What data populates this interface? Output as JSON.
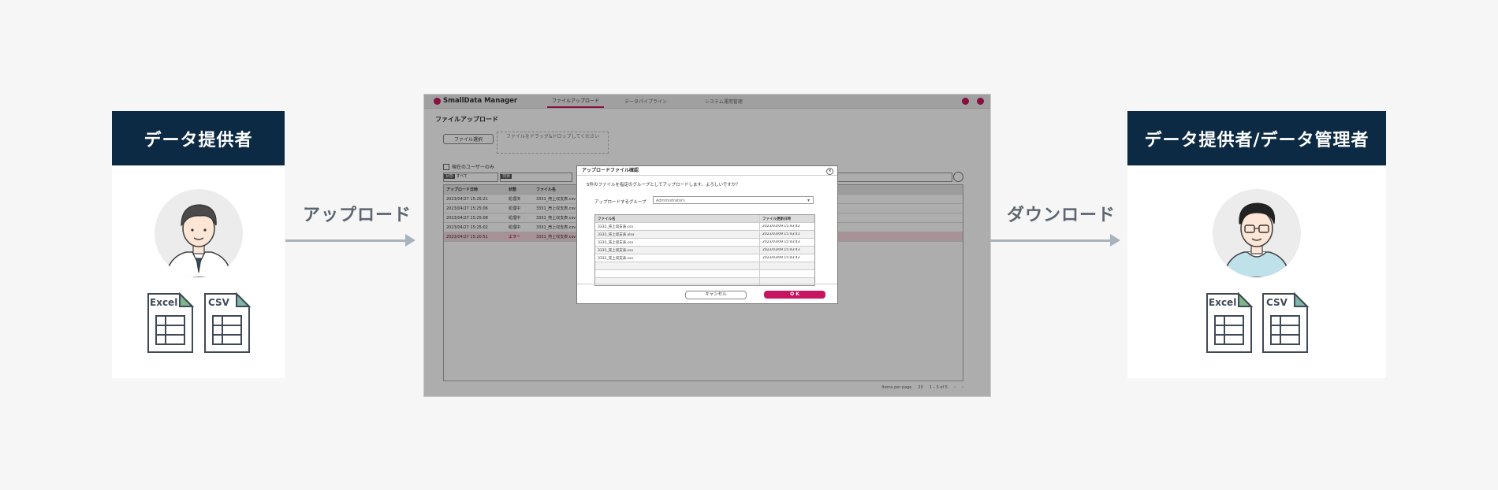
{
  "left_card": {
    "title": "データ提供者"
  },
  "right_card": {
    "title": "データ提供者/データ管理者"
  },
  "upload_label": "アップロード",
  "download_label": "ダウンロード",
  "file_icons": {
    "excel": "Excel",
    "csv": "CSV"
  },
  "app": {
    "logo": "SmallData Manager",
    "tabs": [
      "ファイルアップロード",
      "データパイプライン",
      "システム運用管理"
    ],
    "page_title": "ファイルアップロード",
    "file_select_button": "ファイル選択",
    "drop_hint": "ファイルをドラッグ&ドロップしてください",
    "own_user_only": "現在のユーザーのみ",
    "status_filter": {
      "tag": "状態",
      "value": "すべて"
    },
    "keyword_filter": {
      "tag": "検索"
    },
    "grid": {
      "headers": [
        "アップロード日時",
        "状態",
        "ファイル名"
      ],
      "rows": [
        {
          "date": "2023/04/27 15:25:21",
          "status": "処理済",
          "file": "3331_売上収支表.csv"
        },
        {
          "date": "2023/04/27 15:25:06",
          "status": "処理中",
          "file": "3331_売上収支表.csv"
        },
        {
          "date": "2023/04/27 15:25:08",
          "status": "処理中",
          "file": "3331_売上収支表.csv"
        },
        {
          "date": "2023/04/27 15:25:02",
          "status": "処理中",
          "file": "3331_売上収支表.csv"
        },
        {
          "date": "2023/04/27 15:20:51",
          "status": "エラー",
          "file": "3331_売上収支表.csv"
        }
      ]
    },
    "pager": {
      "items_label": "Items per page",
      "items_value": "20",
      "range": "1 – 5 of 5"
    }
  },
  "modal": {
    "title": "アップロードファイル確認",
    "message": "5件のファイルを指定のグループとしてアップロードします。よろしいですか？",
    "group_label": "アップロードするグループ",
    "group_value": "Administrators",
    "headers": [
      "ファイル名",
      "ファイル更新日時"
    ],
    "rows": [
      {
        "file": "3331_売上収支表.csv",
        "date": "2023/03/09 15:43:42"
      },
      {
        "file": "3331_売上収支表.xlsx",
        "date": "2023/03/09 15:43:41"
      },
      {
        "file": "3331_売上収支表.csv",
        "date": "2023/03/09 15:43:43"
      },
      {
        "file": "3331_売上収支表.csv",
        "date": "2023/03/09 15:43:43"
      },
      {
        "file": "3331_売上収支表.csv",
        "date": "2023/03/09 15:43:42"
      }
    ],
    "cancel": "キャンセル",
    "ok": "O K"
  }
}
